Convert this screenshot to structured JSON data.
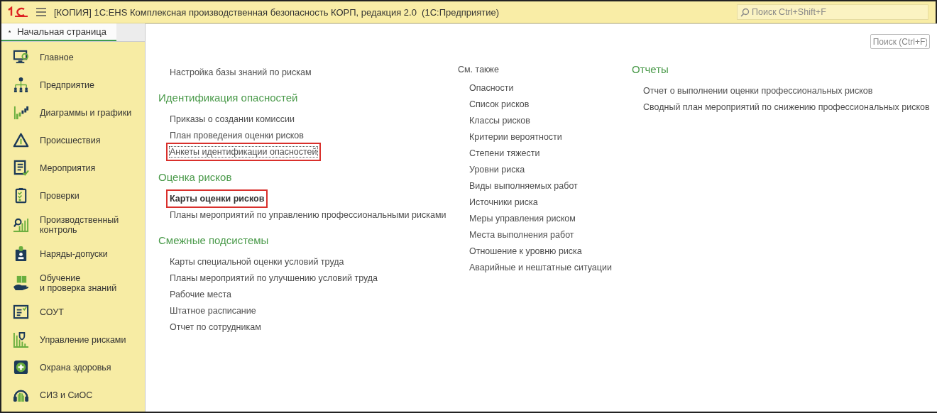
{
  "window": {
    "title": "[КОПИЯ] 1С:EHS Комплексная производственная безопасность КОРП, редакция 2.0  (1С:Предприятие)",
    "search": {
      "placeholder": "Поиск Ctrl+Shift+F"
    }
  },
  "tabs": [
    {
      "label": "Начальная страница",
      "selected": true
    }
  ],
  "sidebar": {
    "items": [
      {
        "label": "Главное"
      },
      {
        "label": "Предприятие"
      },
      {
        "label": "Диаграммы и графики"
      },
      {
        "label": "Происшествия"
      },
      {
        "label": "Мероприятия"
      },
      {
        "label": "Проверки"
      },
      {
        "label": "Производственный\nконтроль"
      },
      {
        "label": "Наряды-допуски"
      },
      {
        "label": "Обучение\nи проверка знаний"
      },
      {
        "label": "СОУТ"
      },
      {
        "label": "Управление рисками"
      },
      {
        "label": "Охрана здоровья"
      },
      {
        "label": "СИЗ и СиОС"
      }
    ]
  },
  "content": {
    "search": {
      "placeholder": "Поиск (Ctrl+F)"
    },
    "columns": [
      {
        "sections": [
          {
            "items": [
              {
                "label": "Настройка базы знаний по рискам",
                "bold": false,
                "highlighted": false,
                "focused": false
              }
            ]
          },
          {
            "heading": "Идентификация опасностей",
            "items": [
              {
                "label": "Приказы о создании комиссии",
                "bold": false,
                "highlighted": false,
                "focused": false
              },
              {
                "label": "План проведения оценки рисков",
                "bold": false,
                "highlighted": false,
                "focused": false
              },
              {
                "label": "Анкеты идентификации опасностей",
                "bold": false,
                "highlighted": true,
                "focused": true
              }
            ]
          },
          {
            "heading": "Оценка рисков",
            "items": [
              {
                "label": "Карты оценки рисков",
                "bold": true,
                "highlighted": true,
                "focused": false
              },
              {
                "label": "Планы мероприятий по управлению профессиональными рисками",
                "bold": false,
                "highlighted": false,
                "focused": false
              }
            ]
          },
          {
            "heading": "Смежные подсистемы",
            "items": [
              {
                "label": "Карты специальной оценки условий труда",
                "bold": false,
                "highlighted": false,
                "focused": false
              },
              {
                "label": "Планы мероприятий по улучшению условий труда",
                "bold": false,
                "highlighted": false,
                "focused": false
              },
              {
                "label": "Рабочие места",
                "bold": false,
                "highlighted": false,
                "focused": false
              },
              {
                "label": "Штатное расписание",
                "bold": false,
                "highlighted": false,
                "focused": false
              },
              {
                "label": "Отчет по сотрудникам",
                "bold": false,
                "highlighted": false,
                "focused": false
              }
            ]
          }
        ]
      },
      {
        "sections": [
          {
            "kind": "see-also",
            "heading": "См. также",
            "items": [
              {
                "label": "Опасности",
                "bold": false,
                "highlighted": false,
                "focused": false
              },
              {
                "label": "Список рисков",
                "bold": false,
                "highlighted": false,
                "focused": false
              },
              {
                "label": "Классы рисков",
                "bold": false,
                "highlighted": false,
                "focused": false
              },
              {
                "label": "Критерии вероятности",
                "bold": false,
                "highlighted": false,
                "focused": false
              },
              {
                "label": "Степени тяжести",
                "bold": false,
                "highlighted": false,
                "focused": false
              },
              {
                "label": "Уровни риска",
                "bold": false,
                "highlighted": false,
                "focused": false
              },
              {
                "label": "Виды выполняемых работ",
                "bold": false,
                "highlighted": false,
                "focused": false
              },
              {
                "label": "Источники риска",
                "bold": false,
                "highlighted": false,
                "focused": false
              },
              {
                "label": "Меры управления риском",
                "bold": false,
                "highlighted": false,
                "focused": false
              },
              {
                "label": "Места выполнения работ",
                "bold": false,
                "highlighted": false,
                "focused": false
              },
              {
                "label": "Отношение к уровню риска",
                "bold": false,
                "highlighted": false,
                "focused": false
              },
              {
                "label": "Аварийные и нештатные ситуации",
                "bold": false,
                "highlighted": false,
                "focused": false
              }
            ]
          }
        ]
      },
      {
        "sections": [
          {
            "kind": "group",
            "heading": "Отчеты",
            "items": [
              {
                "label": "Отчет о выполнении оценки профессиональных рисков",
                "bold": false,
                "highlighted": false,
                "focused": false
              },
              {
                "label": "Сводный план мероприятий по снижению профессиональных рисков",
                "bold": false,
                "highlighted": false,
                "focused": false
              }
            ]
          }
        ]
      }
    ]
  }
}
